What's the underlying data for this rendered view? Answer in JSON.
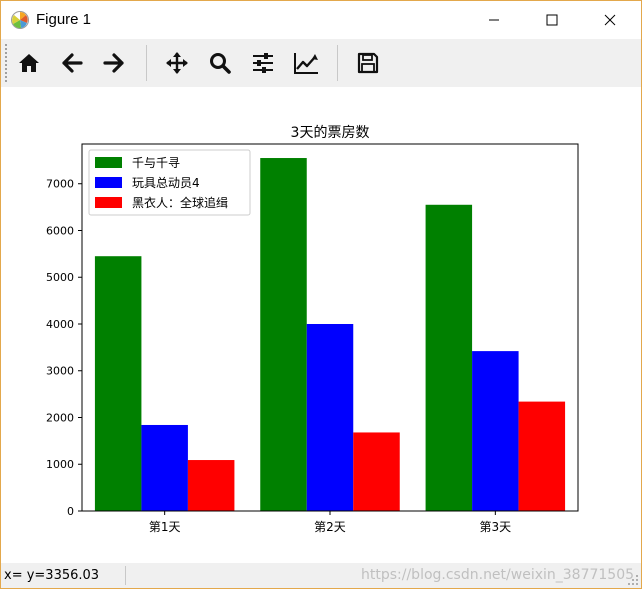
{
  "window": {
    "title": "Figure 1",
    "icon": "matplotlib-logo-icon",
    "controls": [
      "minimize-icon",
      "maximize-icon",
      "close-icon"
    ]
  },
  "toolbar": {
    "buttons": [
      {
        "name": "home",
        "icon": "home-icon"
      },
      {
        "name": "back",
        "icon": "arrow-left-icon"
      },
      {
        "name": "forward",
        "icon": "arrow-right-icon"
      },
      {
        "name": "pan",
        "icon": "move-icon"
      },
      {
        "name": "zoom",
        "icon": "zoom-icon"
      },
      {
        "name": "configure-subplots",
        "icon": "sliders-icon"
      },
      {
        "name": "edit-axis",
        "icon": "line-chart-icon"
      },
      {
        "name": "save",
        "icon": "save-icon"
      }
    ]
  },
  "status": {
    "coords": "x= y=3356.03",
    "watermark": "https://blog.csdn.net/weixin_38771505"
  },
  "colors": {
    "series1": "#008000",
    "series2": "#0000ff",
    "series3": "#ff0000"
  },
  "chart_data": {
    "type": "bar",
    "title": "3天的票房数",
    "categories": [
      "第1天",
      "第2天",
      "第3天"
    ],
    "series": [
      {
        "name": "千与千寻",
        "values": [
          5450,
          7550,
          6550
        ]
      },
      {
        "name": "玩具总动员4",
        "values": [
          1840,
          4000,
          3420
        ]
      },
      {
        "name": "黑衣人：全球追缉",
        "values": [
          1090,
          1680,
          2340
        ]
      }
    ],
    "yticks": [
      0,
      1000,
      2000,
      3000,
      4000,
      5000,
      6000,
      7000
    ],
    "ylim": [
      0,
      7850
    ],
    "xlabel": "",
    "ylabel": "",
    "legend": "upper left",
    "grid": false
  }
}
